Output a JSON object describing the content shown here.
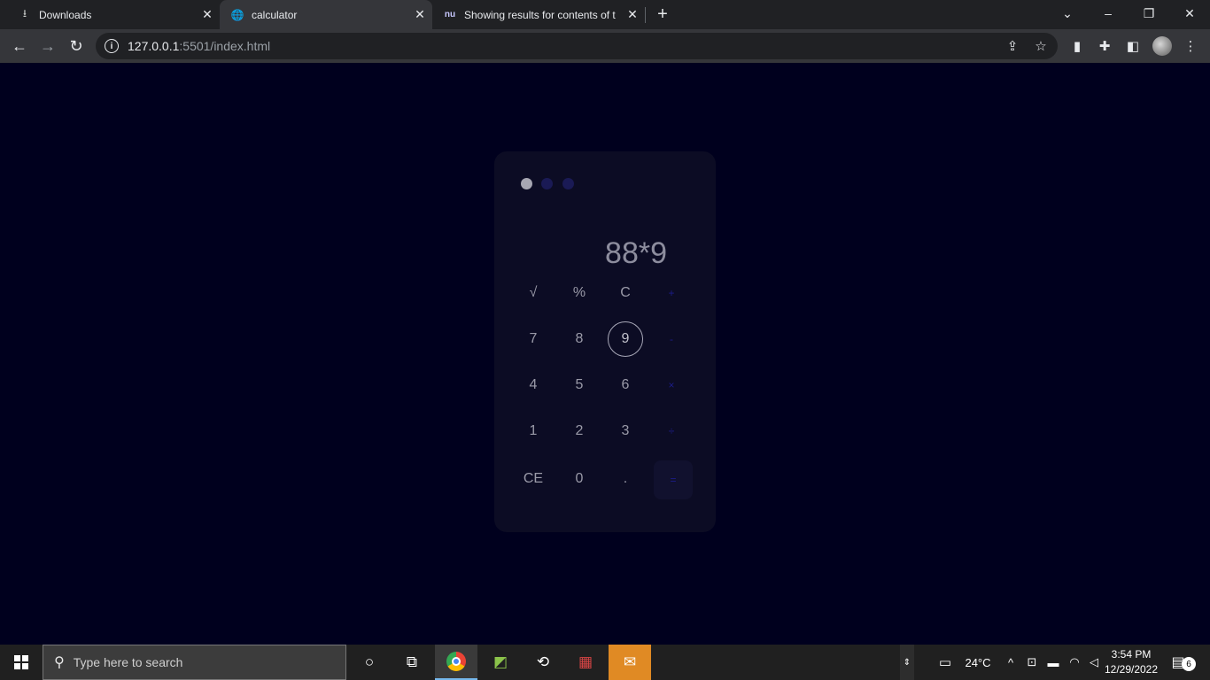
{
  "browser": {
    "tabs": [
      {
        "title": "Downloads",
        "icon": "download-icon"
      },
      {
        "title": "calculator",
        "icon": "globe-icon"
      },
      {
        "title": "Showing results for contents of t",
        "icon": "nu-favicon"
      }
    ],
    "address": {
      "host": "127.0.0.1",
      "path": ":5501/index.html"
    }
  },
  "calculator": {
    "display": "88*9",
    "dot_colors": [
      "#a6a6b2",
      "#1a1a55",
      "#1a1a55"
    ],
    "keys": [
      "√",
      "%",
      "C",
      "+",
      "7",
      "8",
      "9",
      "-",
      "4",
      "5",
      "6",
      "×",
      "1",
      "2",
      "3",
      "÷",
      "CE",
      "0",
      ".",
      "="
    ],
    "highlighted_key": "9"
  },
  "taskbar": {
    "search_placeholder": "Type here to search",
    "weather": "24°C",
    "time": "3:54 PM",
    "date": "12/29/2022",
    "notification_count": "6"
  },
  "colors": {
    "page_bg": "#00001e",
    "calc_bg": "#0c0c24",
    "operator": "#1c1c88"
  }
}
